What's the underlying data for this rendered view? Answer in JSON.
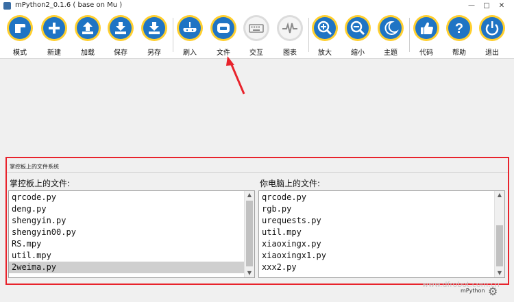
{
  "window": {
    "title": "mPython2_0.1.6 ( base on Mu )",
    "controls": [
      "—",
      "□",
      "✕"
    ]
  },
  "toolbar": [
    {
      "label": "模式",
      "icon": "mode-icon"
    },
    {
      "label": "新建",
      "icon": "plus-icon"
    },
    {
      "label": "加载",
      "icon": "upload-icon"
    },
    {
      "label": "保存",
      "icon": "download-icon"
    },
    {
      "label": "另存",
      "icon": "download-icon"
    },
    {
      "label": "刷入",
      "icon": "flash-board-icon"
    },
    {
      "label": "文件",
      "icon": "files-icon"
    },
    {
      "label": "交互",
      "icon": "keyboard-icon"
    },
    {
      "label": "图表",
      "icon": "pulse-chart-icon"
    },
    {
      "label": "放大",
      "icon": "zoom-in-icon"
    },
    {
      "label": "缩小",
      "icon": "zoom-out-icon"
    },
    {
      "label": "主题",
      "icon": "moon-icon"
    },
    {
      "label": "代码",
      "icon": "thumbs-up-icon"
    },
    {
      "label": "帮助",
      "icon": "help-icon"
    },
    {
      "label": "退出",
      "icon": "power-icon"
    }
  ],
  "files_panel": {
    "title": "掌控板上的文件系统",
    "board": {
      "heading": "掌控板上的文件:",
      "items": [
        "qrcode.py",
        "deng.py",
        "shengyin.py",
        "shengyin00.py",
        "RS.mpy",
        "util.mpy",
        "2weima.py"
      ],
      "selected_index": 6
    },
    "computer": {
      "heading": "你电脑上的文件:",
      "items": [
        "qrcode.py",
        "rgb.py",
        "urequests.py",
        "util.mpy",
        "xiaoxingx.py",
        "xiaoxingx1.py",
        "xxx2.py"
      ]
    }
  },
  "footer": {
    "logo": "mPython",
    "watermark": "www.dfrobot.com.cn"
  },
  "colors": {
    "accent": "#ffcf2e",
    "icon_blue": "#1f74c4",
    "highlight": "#e8232c"
  }
}
